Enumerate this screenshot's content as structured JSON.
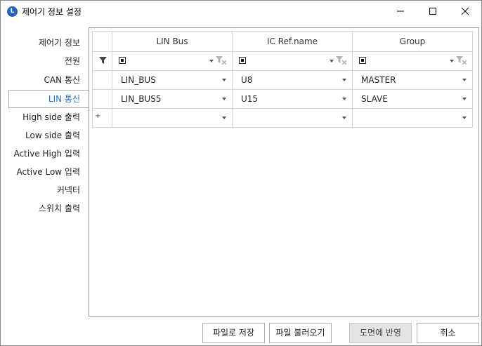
{
  "window": {
    "title": "제어기 정보 설정",
    "icon_letter": "L"
  },
  "sidebar": {
    "items": [
      {
        "label": "제어기 정보"
      },
      {
        "label": "전원"
      },
      {
        "label": "CAN 통신"
      },
      {
        "label": "LIN 통신",
        "selected": true
      },
      {
        "label": "High side 출력"
      },
      {
        "label": "Low side 출력"
      },
      {
        "label": "Active High 입력"
      },
      {
        "label": "Active Low 입력"
      },
      {
        "label": "커넥터"
      },
      {
        "label": "스위치 출력"
      }
    ]
  },
  "grid": {
    "columns": [
      "LIN Bus",
      "IC Ref.name",
      "Group"
    ],
    "rows": [
      [
        "LIN_BUS",
        "U8",
        "MASTER"
      ],
      [
        "LIN_BUS5",
        "U15",
        "SLAVE"
      ]
    ],
    "new_row_marker": "+"
  },
  "buttons": {
    "save_file": "파일로 저장",
    "load_file": "파일 불러오기",
    "apply_drawing": "도면에 반영",
    "cancel": "취소"
  },
  "colors": {
    "accent": "#1e6fd0",
    "disabled_button": "#e4e4e4"
  },
  "icons": [
    "app-logo-icon",
    "minimize-icon",
    "maximize-icon",
    "close-icon",
    "filter-icon",
    "clear-filter-icon",
    "dropdown-arrow-icon"
  ]
}
